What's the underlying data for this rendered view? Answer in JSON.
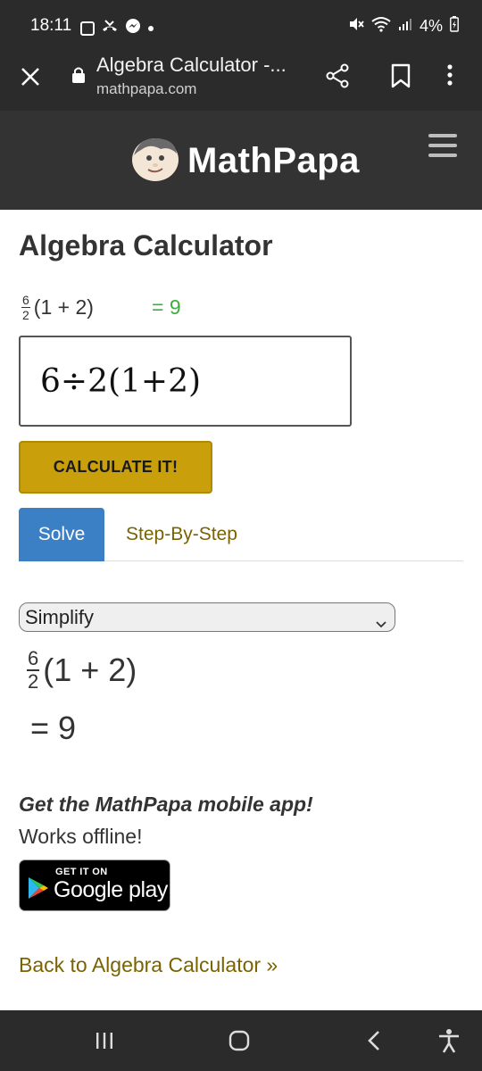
{
  "status_bar": {
    "time": "18:11",
    "battery": "4%"
  },
  "browser": {
    "page_title": "Algebra Calculator -...",
    "url": "mathpapa.com"
  },
  "site": {
    "logo_text": "MathPapa"
  },
  "main": {
    "title": "Algebra Calculator",
    "preview": {
      "frac_num": "6",
      "frac_den": "2",
      "expr_rest": "(1 + 2)",
      "result": "= 9"
    },
    "input_value": "6÷2(1+2)",
    "calculate_label": "CALCULATE IT!",
    "tabs": [
      {
        "label": "Solve",
        "active": true
      },
      {
        "label": "Step-By-Step",
        "active": false
      }
    ],
    "select_value": "Simplify",
    "result": {
      "frac_num": "6",
      "frac_den": "2",
      "expr_rest": "(1 + 2)",
      "equals": "= 9"
    },
    "app_promo": {
      "heading": "Get the MathPapa mobile app!",
      "subtext": "Works offline!",
      "badge_small": "GET IT ON",
      "badge_big": "Google play"
    },
    "back_link": "Back to Algebra Calculator »"
  },
  "colors": {
    "header_bg": "#333333",
    "calc_button": "#c9a00c",
    "solve_tab": "#3b7fc4",
    "link": "#7a6300",
    "preview_result": "#3cae3c"
  }
}
